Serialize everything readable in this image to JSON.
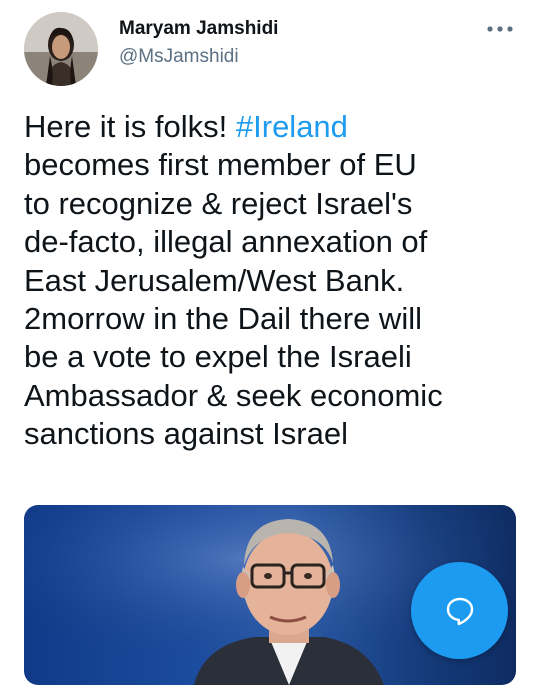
{
  "tweet": {
    "author": {
      "display_name": "Maryam Jamshidi",
      "handle": "@MsJamshidi"
    },
    "text_before_hashtag": "Here it is folks! ",
    "hashtag": "#Ireland",
    "text_after_hashtag": "\nbecomes first member of EU\nto recognize & reject Israel's\nde-facto, illegal annexation of\nEast Jerusalem/West Bank.\n2morrow in the Dail there will\nbe a vote to expel the Israeli\nAmbassador & seek economic\nsanctions against Israel",
    "more_icon": "more-horizontal-icon"
  },
  "compose_button": {
    "icon": "compose-bubble-icon",
    "color": "#1d9bf0"
  },
  "colors": {
    "accent": "#1d9bf0",
    "secondary_text": "#5b7083"
  }
}
